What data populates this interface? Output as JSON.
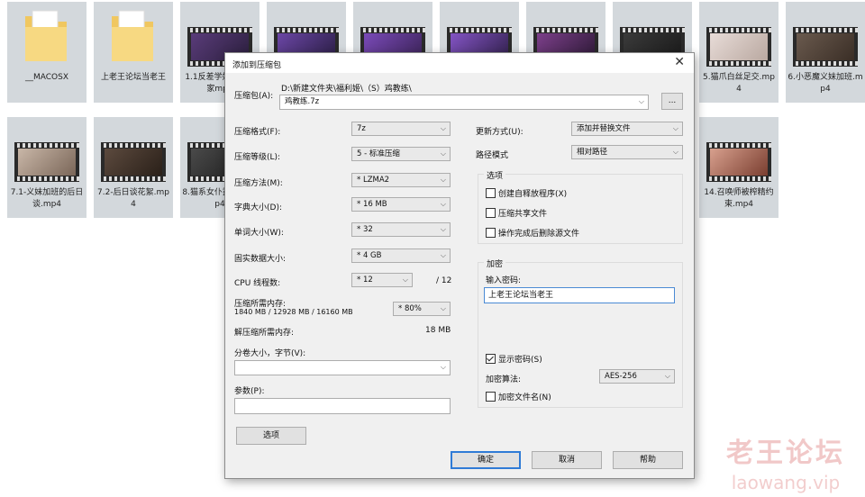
{
  "files": [
    {
      "label": "__MACOSX",
      "kind": "folder"
    },
    {
      "label": "上老王论坛当老王",
      "kind": "folder"
    },
    {
      "label": "1.1反差学妹来到我家mp4",
      "kind": "video"
    },
    {
      "label": "",
      "kind": "video"
    },
    {
      "label": "",
      "kind": "video"
    },
    {
      "label": "",
      "kind": "video"
    },
    {
      "label": "",
      "kind": "video"
    },
    {
      "label": "",
      "kind": "video"
    },
    {
      "label": "5.猫爪白丝足交.mp4",
      "kind": "video"
    },
    {
      "label": "6.小恶魔义妹加班.mp4",
      "kind": "video"
    },
    {
      "label": "7.1-义妹加班的后日谈.mp4",
      "kind": "video"
    },
    {
      "label": "7.2-后日谈花絮.mp4",
      "kind": "video"
    },
    {
      "label": "8.猫系女仆露单单.mp4",
      "kind": "video"
    },
    {
      "label": "14.召唤师被榨精约束.mp4",
      "kind": "video"
    }
  ],
  "dialog": {
    "title": "添加到压缩包",
    "archive_label": "压缩包(A):",
    "archive_path": "D:\\新建文件夹\\福利姬\\（S）鸡教练\\",
    "archive_name": "鸡教练.7z",
    "browse_label": "...",
    "left": {
      "format_label": "压缩格式(F):",
      "format_value": "7z",
      "level_label": "压缩等级(L):",
      "level_value": "5 - 标准压缩",
      "method_label": "压缩方法(M):",
      "method_value": "* LZMA2",
      "dict_label": "字典大小(D):",
      "dict_value": "* 16 MB",
      "word_label": "单词大小(W):",
      "word_value": "* 32",
      "solid_label": "固实数据大小:",
      "solid_value": "* 4 GB",
      "cpu_label": "CPU 线程数:",
      "cpu_value": "* 12",
      "cpu_total": "/ 12",
      "mem_label": "压缩所需内存:",
      "mem_detail": "1840 MB / 12928 MB / 16160 MB",
      "mem_pct": "* 80%",
      "decomp_label": "解压缩所需内存:",
      "decomp_value": "18 MB",
      "split_label": "分卷大小，字节(V):",
      "split_value": "",
      "params_label": "参数(P):",
      "params_value": "",
      "options_button": "选项"
    },
    "right": {
      "update_label": "更新方式(U):",
      "update_value": "添加并替换文件",
      "path_label": "路径模式",
      "path_value": "相对路径",
      "options_group": "选项",
      "opt_sfx": "创建自释放程序(X)",
      "opt_shared": "压缩共享文件",
      "opt_delete": "操作完成后删除源文件",
      "encrypt_group": "加密",
      "password_label": "输入密码:",
      "password_value": "上老王论坛当老王",
      "show_password": "显示密码(S)",
      "algo_label": "加密算法:",
      "algo_value": "AES-256",
      "encrypt_names": "加密文件名(N)"
    },
    "buttons": {
      "ok": "确定",
      "cancel": "取消",
      "help": "帮助"
    }
  },
  "watermark": {
    "line1": "老王论坛",
    "line2": "laowang.vip"
  },
  "colors": {
    "accent": "#2f7bd6",
    "tile": "#d3d8dc",
    "folder": "#f4d27a"
  }
}
